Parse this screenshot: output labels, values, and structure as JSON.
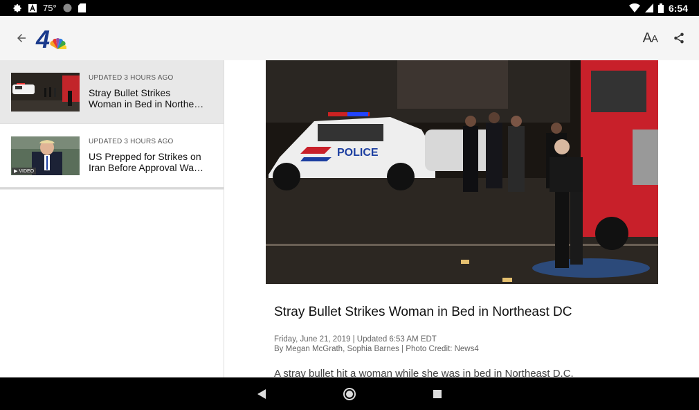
{
  "status_bar": {
    "temperature": "75°",
    "time": "6:54"
  },
  "app_bar": {
    "logo_text": "4",
    "font_size_label_big": "A",
    "font_size_label_small": "A"
  },
  "stories": [
    {
      "updated": "UPDATED 3 HOURS AGO",
      "headline": "Stray Bullet Strikes Woman in Bed in Northe…",
      "selected": true
    },
    {
      "updated": "UPDATED 3 HOURS AGO",
      "headline": "US Prepped for Strikes on Iran Before Approval Wa…",
      "badge": "VIDEO",
      "selected": false
    }
  ],
  "article": {
    "hero_text": "POLICE",
    "title": "Stray Bullet Strikes Woman in Bed in Northeast DC",
    "date_line": "Friday, June 21, 2019 | Updated 6:53 AM EDT",
    "byline": "By Megan McGrath, Sophia Barnes | Photo Credit: News4",
    "first_paragraph": "A stray bullet hit a woman while she was in bed in Northeast D.C."
  },
  "colors": {
    "status_bar": "#000000",
    "app_bar": "#f5f5f5",
    "selected_item": "#e8e8e8",
    "logo_blue": "#1a3a8c"
  }
}
